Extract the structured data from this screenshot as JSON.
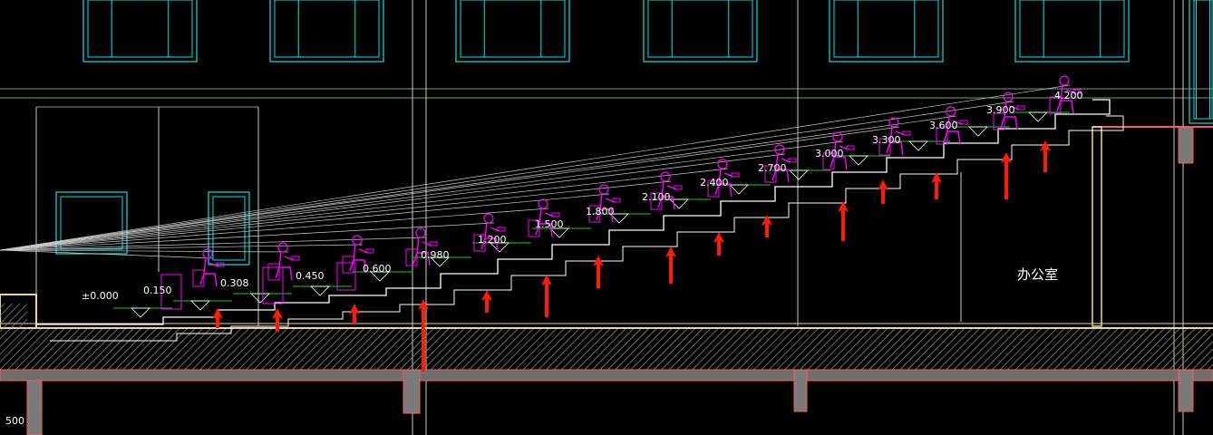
{
  "levels": [
    {
      "id": "l0",
      "text": "±0.000"
    },
    {
      "id": "l1",
      "text": "0.150"
    },
    {
      "id": "l2",
      "text": "0.308"
    },
    {
      "id": "l3",
      "text": "0.450"
    },
    {
      "id": "l4",
      "text": "0.600"
    },
    {
      "id": "l5",
      "text": "0.980"
    },
    {
      "id": "l6",
      "text": "1.200"
    },
    {
      "id": "l7",
      "text": "1.500"
    },
    {
      "id": "l8",
      "text": "1.800"
    },
    {
      "id": "l9",
      "text": "2.100"
    },
    {
      "id": "l10",
      "text": "2.400"
    },
    {
      "id": "l11",
      "text": "2.700"
    },
    {
      "id": "l12",
      "text": "3.000"
    },
    {
      "id": "l13",
      "text": "3.300"
    },
    {
      "id": "l14",
      "text": "3.600"
    },
    {
      "id": "l15",
      "text": "3.900"
    },
    {
      "id": "l16",
      "text": "4.200"
    }
  ],
  "room_label": "办公室",
  "corner_label": "500",
  "colors": {
    "background": "#000000",
    "window": "#00e5e5",
    "seat": "#ff00ff",
    "arrow": "#ff1a0a",
    "structure": "#e6d89a",
    "hatch": "#8a8a8a",
    "wall_outline": "#ff5a5a",
    "green_line": "#00b000",
    "sight_line": "#c8c8c8",
    "grid_line": "#bcd7b0"
  }
}
